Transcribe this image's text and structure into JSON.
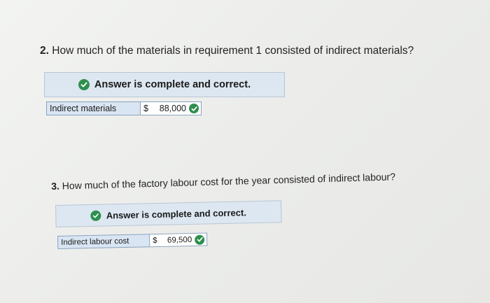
{
  "q2": {
    "number": "2.",
    "text": "How much of the materials in requirement 1 consisted of indirect materials?",
    "banner": "Answer is complete and correct.",
    "row_label": "Indirect materials",
    "currency": "$",
    "amount": "88,000"
  },
  "q3": {
    "number": "3.",
    "text": "How much of the factory labour cost for the year consisted of indirect labour?",
    "banner": "Answer is complete and correct.",
    "row_label": "Indirect labour cost",
    "currency": "$",
    "amount": "69,500"
  },
  "colors": {
    "banner_bg": "#dde7f1",
    "label_bg": "#d9e5f2",
    "check_green": "#2f8f4e"
  },
  "icons": [
    "check-circle-icon"
  ]
}
